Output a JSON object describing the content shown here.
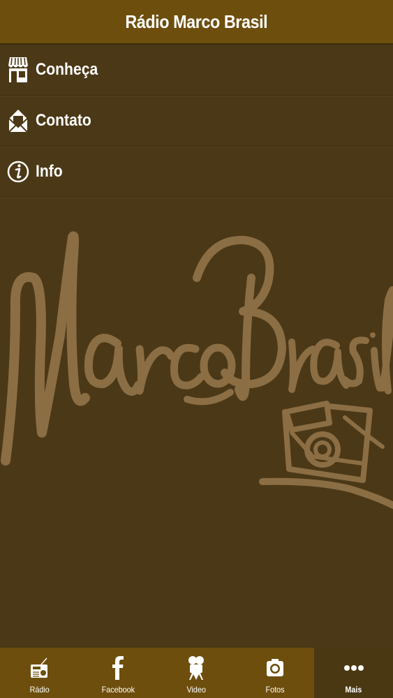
{
  "header": {
    "title": "Rádio Marco Brasil"
  },
  "menu": {
    "items": [
      {
        "label": "Conheça",
        "icon": "store-icon"
      },
      {
        "label": "Contato",
        "icon": "envelope-icon"
      },
      {
        "label": "Info",
        "icon": "info-icon"
      }
    ]
  },
  "watermark": {
    "text": "Marco Brasil"
  },
  "tabbar": {
    "items": [
      {
        "label": "Rádio",
        "icon": "radio-icon",
        "active": false
      },
      {
        "label": "Facebook",
        "icon": "facebook-icon",
        "active": false
      },
      {
        "label": "Video",
        "icon": "video-camera-icon",
        "active": false
      },
      {
        "label": "Fotos",
        "icon": "camera-icon",
        "active": false
      },
      {
        "label": "Mais",
        "icon": "more-dots-icon",
        "active": true
      }
    ]
  },
  "colors": {
    "header_bg": "#6d4e0c",
    "page_bg": "#4b3816",
    "watermark": "#8c6e44",
    "active_tab_bg": "#4a3812"
  }
}
